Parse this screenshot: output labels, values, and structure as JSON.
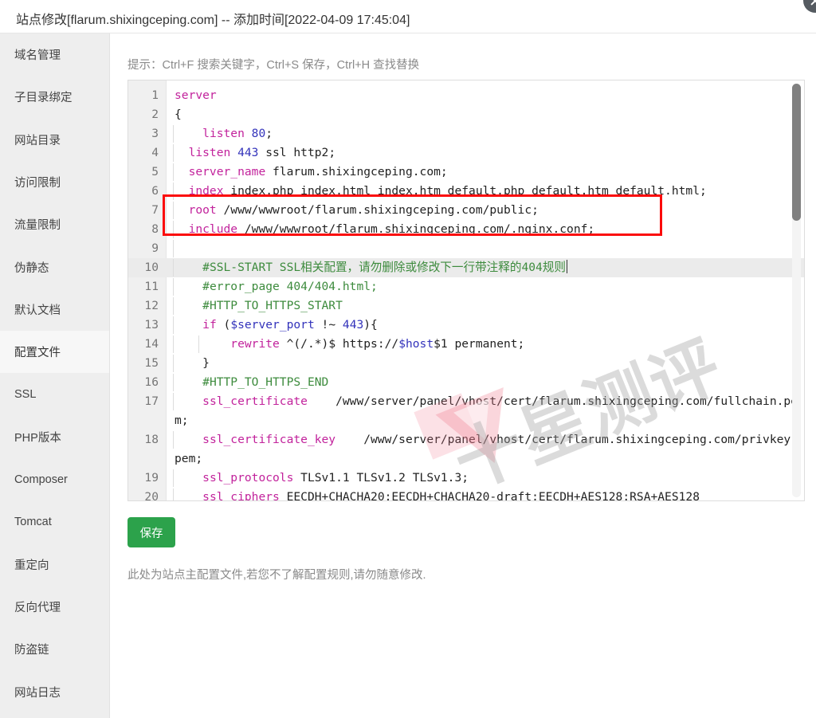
{
  "header": {
    "title": "站点修改[flarum.shixingceping.com] -- 添加时间[2022-04-09 17:45:04]",
    "close_icon": "close-icon"
  },
  "sidebar": {
    "items": [
      {
        "label": "域名管理",
        "active": false
      },
      {
        "label": "子目录绑定",
        "active": false
      },
      {
        "label": "网站目录",
        "active": false
      },
      {
        "label": "访问限制",
        "active": false
      },
      {
        "label": "流量限制",
        "active": false
      },
      {
        "label": "伪静态",
        "active": false
      },
      {
        "label": "默认文档",
        "active": false
      },
      {
        "label": "配置文件",
        "active": true
      },
      {
        "label": "SSL",
        "active": false
      },
      {
        "label": "PHP版本",
        "active": false
      },
      {
        "label": "Composer",
        "active": false
      },
      {
        "label": "Tomcat",
        "active": false
      },
      {
        "label": "重定向",
        "active": false
      },
      {
        "label": "反向代理",
        "active": false
      },
      {
        "label": "防盗链",
        "active": false
      },
      {
        "label": "网站日志",
        "active": false
      }
    ]
  },
  "main": {
    "hint": "提示：Ctrl+F 搜索关键字，Ctrl+S 保存，Ctrl+H 查找替换",
    "save_label": "保存",
    "note": "此处为站点主配置文件,若您不了解配置规则,请勿随意修改.",
    "watermark_text": "十星测评"
  },
  "editor": {
    "highlight_line": 10,
    "annotation_lines": [
      7,
      8
    ],
    "annotation_color": "#fb0b0b",
    "keyword_color": "#c2239c",
    "comment_color": "#3d8b3d",
    "number_color": "#3333bb",
    "lines": [
      {
        "n": 1,
        "text": "server"
      },
      {
        "n": 2,
        "text": "{"
      },
      {
        "n": 3,
        "text": "    listen 80;"
      },
      {
        "n": 4,
        "text": "  listen 443 ssl http2;"
      },
      {
        "n": 5,
        "text": "  server_name flarum.shixingceping.com;"
      },
      {
        "n": 6,
        "text": "  index index.php index.html index.htm default.php default.htm default.html;"
      },
      {
        "n": 7,
        "text": "  root /www/wwwroot/flarum.shixingceping.com/public;"
      },
      {
        "n": 8,
        "text": "  include /www/wwwroot/flarum.shixingceping.com/.nginx.conf;"
      },
      {
        "n": 9,
        "text": ""
      },
      {
        "n": 10,
        "text": "    #SSL-START SSL相关配置，请勿删除或修改下一行带注释的404规则"
      },
      {
        "n": 11,
        "text": "    #error_page 404/404.html;"
      },
      {
        "n": 12,
        "text": "    #HTTP_TO_HTTPS_START"
      },
      {
        "n": 13,
        "text": "    if ($server_port !~ 443){"
      },
      {
        "n": 14,
        "text": "        rewrite ^(/.*)$ https://$host$1 permanent;"
      },
      {
        "n": 15,
        "text": "    }"
      },
      {
        "n": 16,
        "text": "    #HTTP_TO_HTTPS_END"
      },
      {
        "n": 17,
        "text": "    ssl_certificate    /www/server/panel/vhost/cert/flarum.shixingceping.com/fullchain.pem;"
      },
      {
        "n": 18,
        "text": "    ssl_certificate_key    /www/server/panel/vhost/cert/flarum.shixingceping.com/privkey.pem;"
      },
      {
        "n": 19,
        "text": "    ssl_protocols TLSv1.1 TLSv1.2 TLSv1.3;"
      },
      {
        "n": 20,
        "text": "    ssl_ciphers EECDH+CHACHA20:EECDH+CHACHA20-draft:EECDH+AES128:RSA+AES128"
      }
    ]
  }
}
